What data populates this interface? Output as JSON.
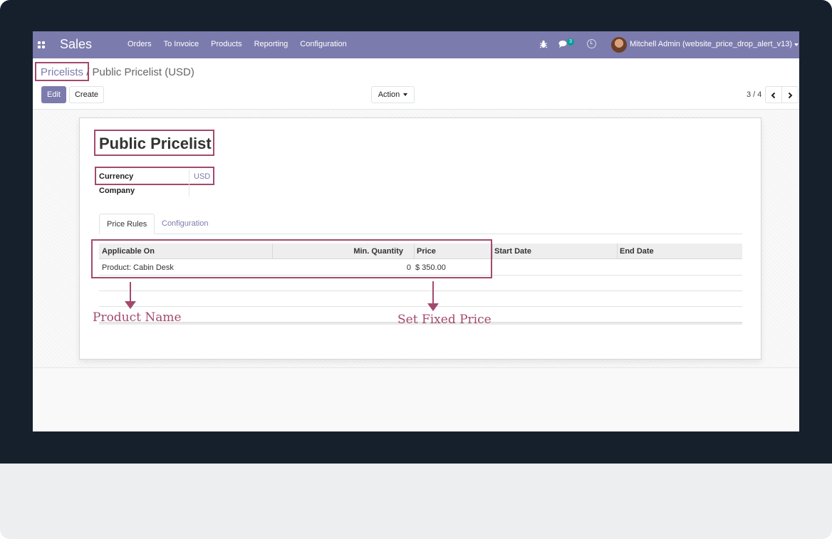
{
  "navbar": {
    "app_name": "Sales",
    "menu": [
      "Orders",
      "To Invoice",
      "Products",
      "Reporting",
      "Configuration"
    ],
    "chat_count": "3",
    "user": "Mitchell Admin (website_price_drop_alert_v13)",
    "bg_color": "#7c7bad"
  },
  "breadcrumb": {
    "parent": "Pricelists",
    "separator": "/",
    "current": "Public Pricelist (USD)"
  },
  "buttons": {
    "edit": "Edit",
    "create": "Create",
    "action": "Action"
  },
  "pager": {
    "value": "3 / 4",
    "prev_icon": "chevron-left-icon",
    "next_icon": "chevron-right-icon"
  },
  "form": {
    "title": "Public Pricelist",
    "currency_label": "Currency",
    "currency_value": "USD",
    "company_label": "Company",
    "company_value": ""
  },
  "tabs": [
    "Price Rules",
    "Configuration"
  ],
  "price_rules": {
    "columns": [
      "Applicable On",
      "Min. Quantity",
      "Price",
      "Start Date",
      "End Date"
    ],
    "rows": [
      {
        "applicable_on": "Product: Cabin Desk",
        "min_quantity": "0",
        "price": "$ 350.00",
        "start_date": "",
        "end_date": ""
      }
    ]
  },
  "annotations": {
    "product_name": "Product Name",
    "fixed_price": "Set Fixed Price",
    "color": "#a3496d"
  }
}
